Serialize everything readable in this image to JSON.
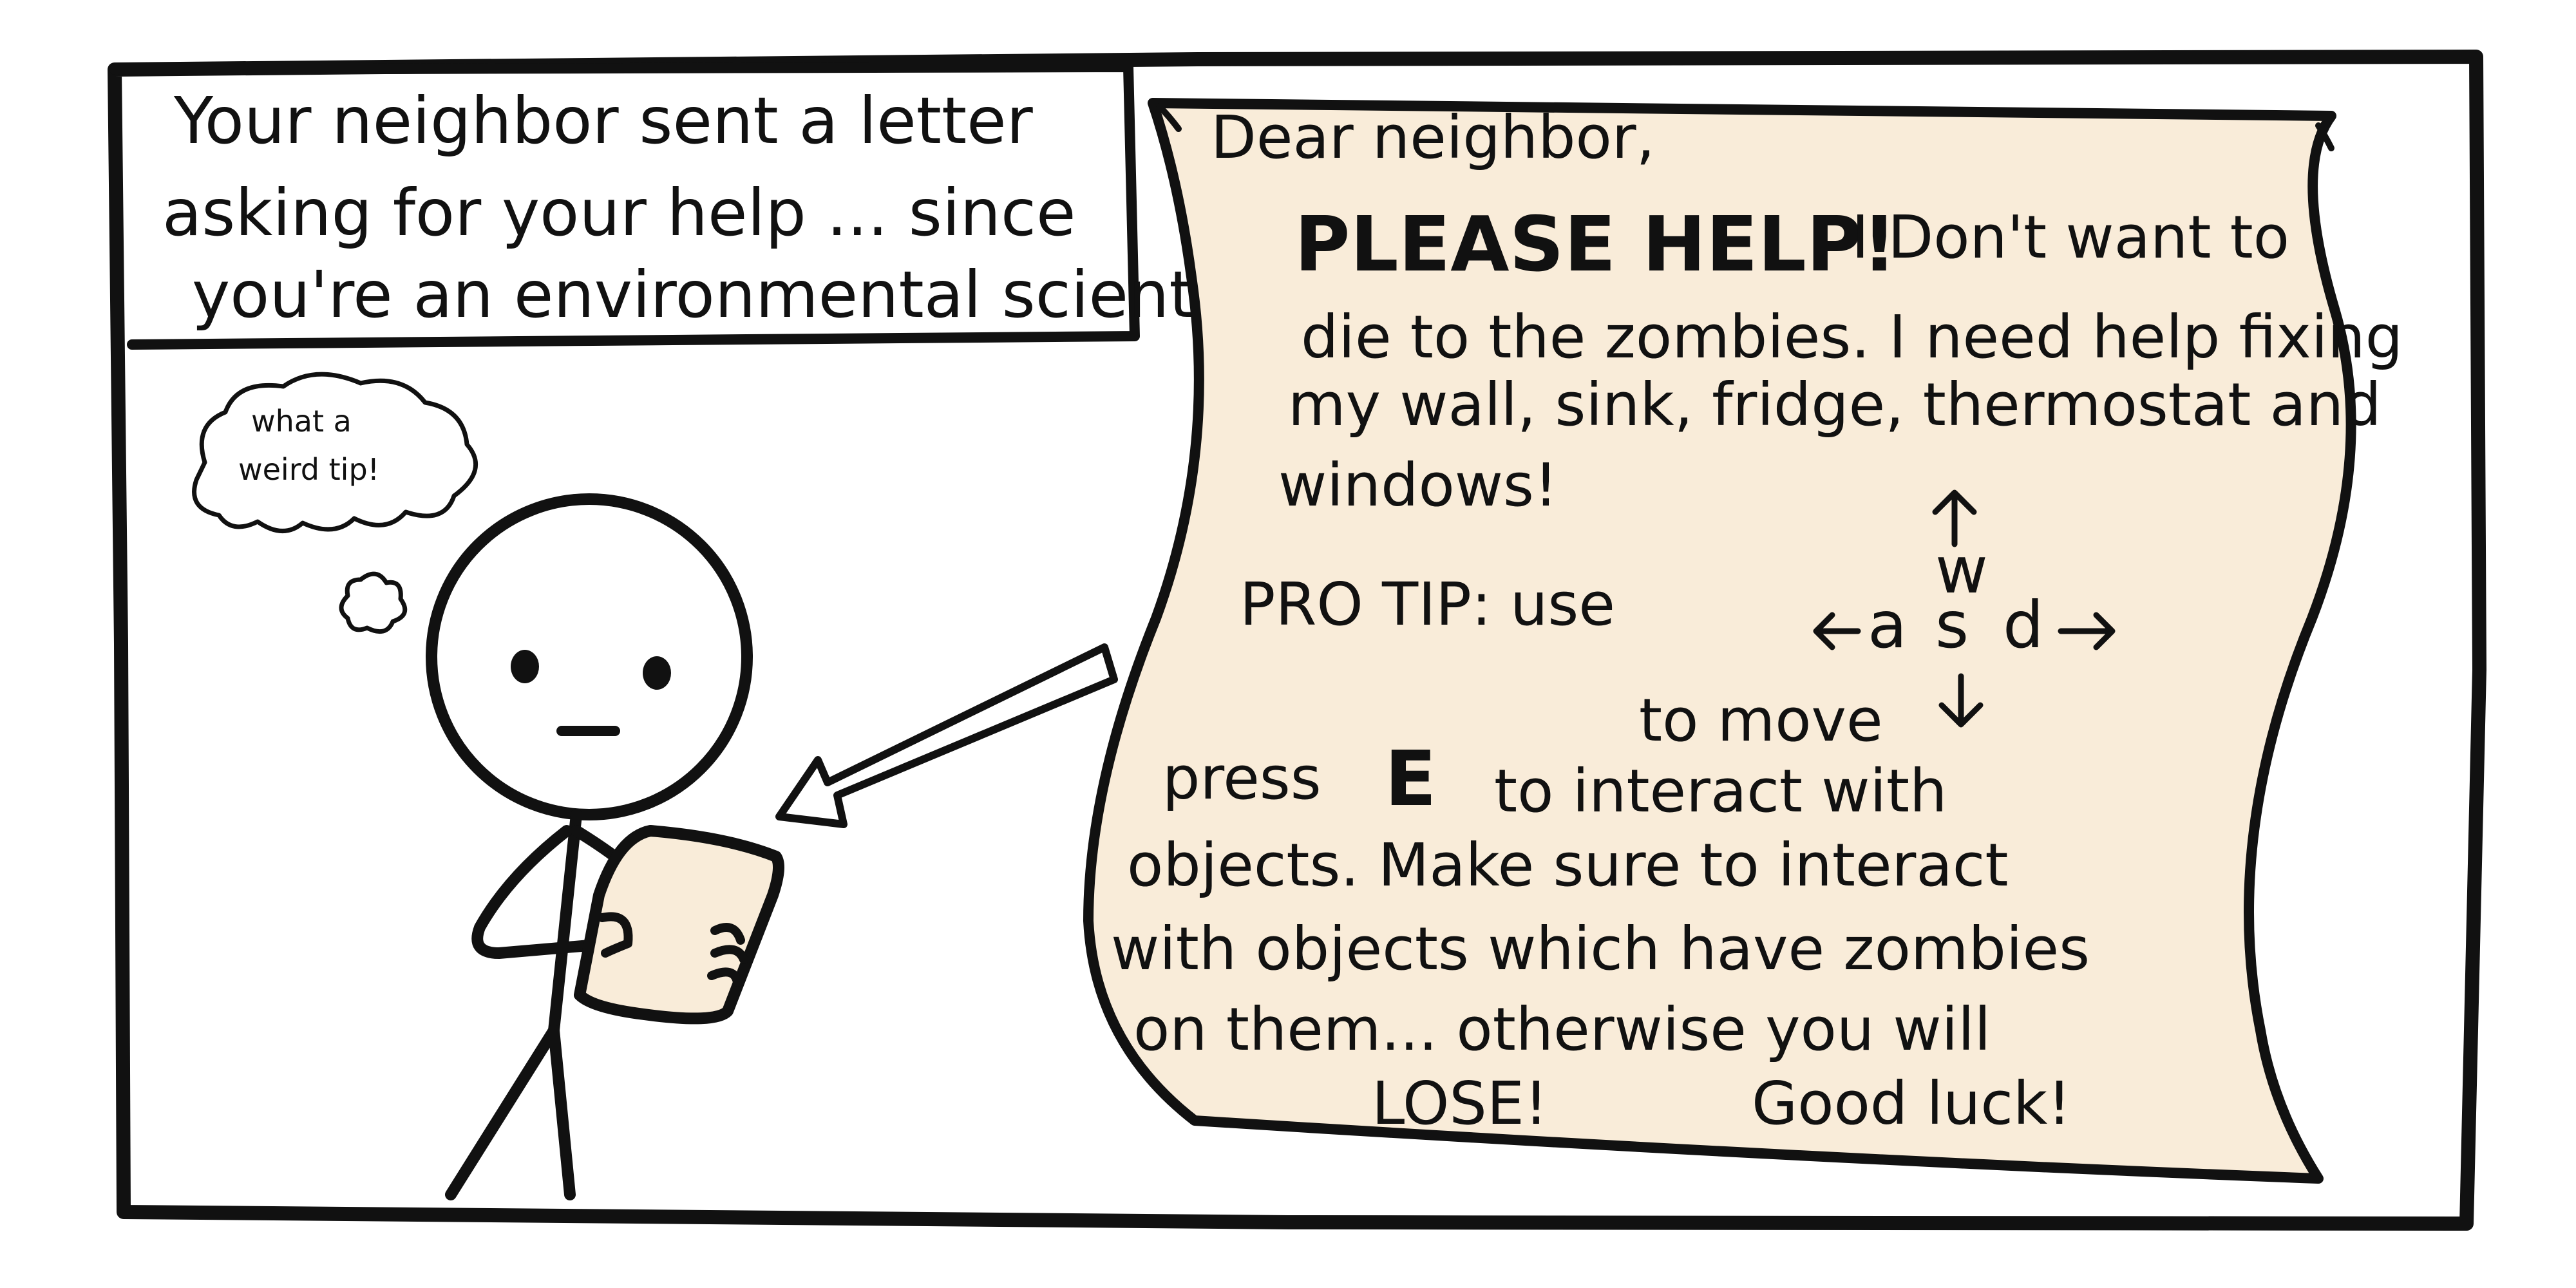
{
  "caption": {
    "line1": "Your neighbor sent a letter",
    "line2": "asking for your help ... since",
    "line3": "you're an environmental scientist!"
  },
  "thought": {
    "line1": "what a",
    "line2": "weird tip!"
  },
  "letter": {
    "greeting": "Dear neighbor,",
    "plea_bold": "PLEASE HELP!",
    "plea_rest": "I Don't want to",
    "line2": "die to the zombies. I need help fixing",
    "line3": "my wall, sink, fridge, thermostat and",
    "line4": "windows!",
    "protip_label": "PRO TIP: use",
    "to_move": "to move",
    "press": "press",
    "press_key": "E",
    "press_rest": "to interact with",
    "line_objects": "objects. Make sure to interact",
    "line_with": "with objects which have zombies",
    "line_on": "on them... otherwise you will",
    "lose": "LOSE!",
    "good_luck": "Good luck!"
  },
  "keys": {
    "w": "w",
    "a": "a",
    "s": "s",
    "d": "d"
  },
  "colors": {
    "ink": "#111111",
    "paper": "#f9ecd9",
    "background": "#ffffff"
  },
  "icons": [
    "stick-figure",
    "thought-bubble",
    "pointing-arrow",
    "scroll-letter"
  ]
}
